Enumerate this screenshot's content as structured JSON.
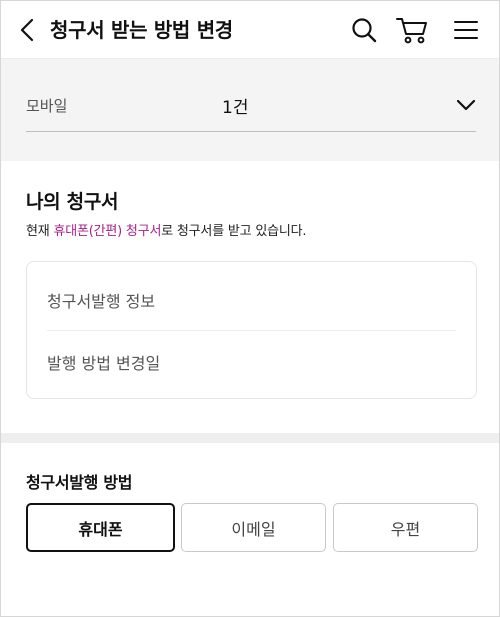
{
  "header": {
    "title": "청구서 받는 방법 변경",
    "icons": [
      "back-icon",
      "search-icon",
      "cart-icon",
      "menu-icon"
    ]
  },
  "line_select": {
    "label": "모바일",
    "value": "1건"
  },
  "my_bill": {
    "title": "나의 청구서",
    "desc_prefix": "현재 ",
    "desc_accent": "휴대폰(간편) 청구서",
    "desc_suffix": "로 청구서를 받고 있습니다.",
    "info_rows": [
      "청구서발행 정보",
      "발행 방법 변경일"
    ]
  },
  "delivery": {
    "title": "청구서발행 방법",
    "options": [
      "휴대폰",
      "이메일",
      "우편"
    ],
    "selected": "휴대폰"
  },
  "colors": {
    "accent": "#a8238a",
    "selected_border": "#111111",
    "band_bg": "#f4f4f4"
  }
}
